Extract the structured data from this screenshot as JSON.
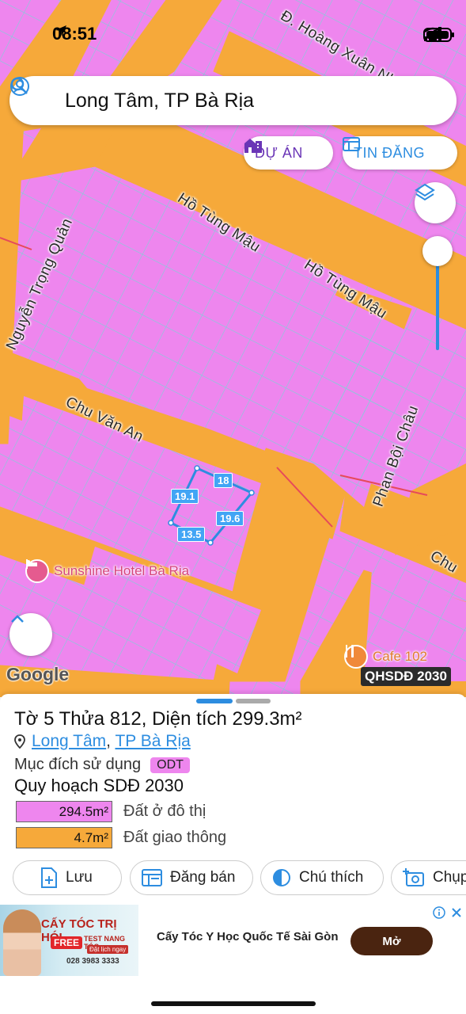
{
  "status_bar": {
    "time": "08:51"
  },
  "search": {
    "query": "Long Tâm, TP Bà Rịa"
  },
  "map_buttons": {
    "du_an": "DỰ ÁN",
    "tin_dang": "TIN ĐĂNG"
  },
  "streets": {
    "hoang_xuan_nhi": "Đ. Hoàng Xuân Nhị",
    "ho_tung_mau_1": "Hồ Tùng Mậu",
    "ho_tung_mau_2": "Hồ Tùng Mậu",
    "nguyen_trong_quan": "Nguyễn Trọng Quản",
    "chu_van_an": "Chu Văn An",
    "phan_boi_chau": "Phan Bội Châu",
    "chu_edge": "Chu"
  },
  "parcel_dimensions": {
    "top": "18",
    "left": "19.1",
    "right": "19.6",
    "bottom": "13.5"
  },
  "pois": {
    "hotel": "Sunshine Hotel Bà Rịa",
    "cafe": "Cafe 102"
  },
  "map_footer": {
    "google": "Google",
    "badge": "QHSDĐ 2030"
  },
  "panel": {
    "title": "Tờ 5 Thửa 812, Diện tích 299.3m²",
    "location_ward": "Long Tâm",
    "location_sep": ",",
    "location_city": "TP Bà Rịa",
    "purpose_label": "Mục đích sử dụng",
    "purpose_code": "ODT",
    "plan_title": "Quy hoạch SDĐ 2030",
    "areas": [
      {
        "value": "294.5m²",
        "label": "Đất ở đô thị",
        "color": "#ee86ee"
      },
      {
        "value": "4.7m²",
        "label": "Đất giao thông",
        "color": "#f6a93a"
      }
    ],
    "actions": {
      "save": "Lưu",
      "post": "Đăng bán",
      "legend": "Chú thích",
      "capture": "Chụp"
    }
  },
  "ad": {
    "headline": "CẤY TÓC TRỊ HÓI",
    "free": "FREE",
    "sub": "TEST NANG TÓC",
    "cta": "Đặt lịch ngay",
    "phone": "028 3983 3333",
    "text": "Cấy Tóc Y Học Quốc Tế Sài Gòn",
    "button": "Mở"
  },
  "colors": {
    "residential": "#ee86ee",
    "road": "#f6a93a",
    "accent": "#2d8de0",
    "purple": "#6a35b6"
  }
}
